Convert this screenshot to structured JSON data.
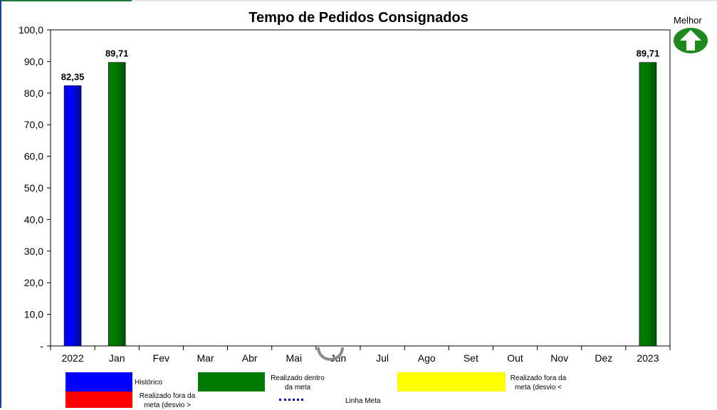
{
  "chart_data": {
    "type": "bar",
    "title": "Tempo de Pedidos Consignados",
    "categories": [
      "2022",
      "Jan",
      "Fev",
      "Mar",
      "Abr",
      "Mai",
      "Jun",
      "Jul",
      "Ago",
      "Set",
      "Out",
      "Nov",
      "Dez",
      "2023"
    ],
    "values": [
      82.35,
      89.71,
      null,
      null,
      null,
      null,
      null,
      null,
      null,
      null,
      null,
      null,
      null,
      89.71
    ],
    "value_labels": [
      "82,35",
      "89,71",
      "",
      "",
      "",
      "",
      "",
      "",
      "",
      "",
      "",
      "",
      "",
      "89,71"
    ],
    "bar_colors": [
      "#0000ff",
      "#007a00",
      null,
      null,
      null,
      null,
      null,
      null,
      null,
      null,
      null,
      null,
      null,
      "#007a00"
    ],
    "ylim": [
      0,
      100
    ],
    "yticks": [
      0,
      10,
      20,
      30,
      40,
      50,
      60,
      70,
      80,
      90,
      100
    ],
    "ytick_labels": [
      "-",
      "10,0",
      "20,0",
      "30,0",
      "40,0",
      "50,0",
      "60,0",
      "70,0",
      "80,0",
      "90,0",
      "100,0"
    ],
    "grid": false
  },
  "indicator": {
    "label": "Melhor",
    "direction": "up",
    "color": "#1e8a1e"
  },
  "legend": {
    "historico": "Histórico",
    "realizado_dentro_1": "Realizado dentro",
    "realizado_dentro_2": "da meta",
    "fora_menor_1": "Realizado fora da",
    "fora_menor_2": "meta (desvio <",
    "fora_maior_1": "Realizado fora da",
    "fora_maior_2": "meta (desvio >",
    "linha_meta": "Linha Meta"
  },
  "colors": {
    "historico": "#0000ff",
    "dentro": "#007a00",
    "fora_menor": "#ffff00",
    "fora_maior": "#ff0000",
    "meta_line": "#0000c0"
  }
}
